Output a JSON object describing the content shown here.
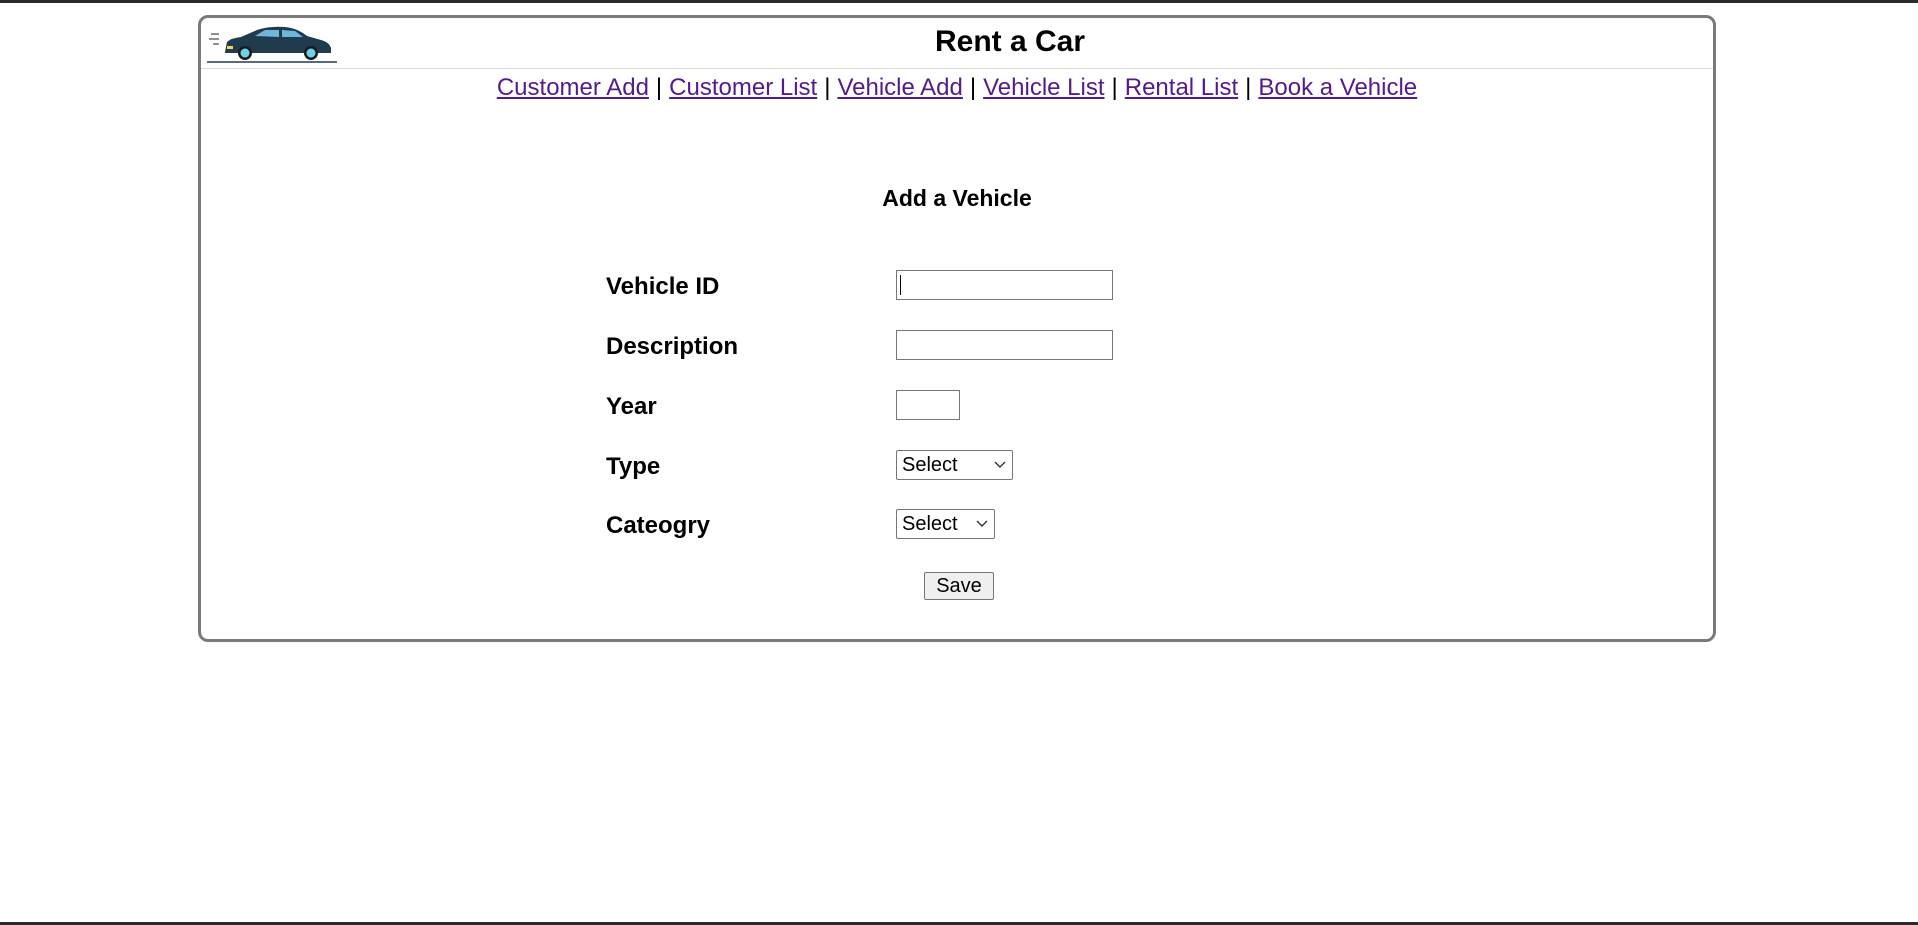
{
  "app": {
    "title": "Rent a Car"
  },
  "nav": {
    "items": [
      {
        "label": "Customer Add"
      },
      {
        "label": "Customer List"
      },
      {
        "label": "Vehicle Add"
      },
      {
        "label": "Vehicle List"
      },
      {
        "label": "Rental List"
      },
      {
        "label": "Book a Vehicle"
      }
    ],
    "separator": "|"
  },
  "form": {
    "title": "Add a Vehicle",
    "vehicle_id": {
      "label": "Vehicle ID",
      "value": ""
    },
    "description": {
      "label": "Description",
      "value": ""
    },
    "year": {
      "label": "Year",
      "value": ""
    },
    "type": {
      "label": "Type",
      "selected": "Select"
    },
    "category": {
      "label": "Cateogry",
      "selected": "Select"
    },
    "save_label": "Save"
  },
  "colors": {
    "link": "#551a8b",
    "frame_border": "#7a7a7a",
    "car_body": "#1f3b4d",
    "car_wheel": "#6fd0ea"
  },
  "icons": {
    "logo": "car-logo-icon",
    "dropdown": "chevron-down-icon"
  }
}
